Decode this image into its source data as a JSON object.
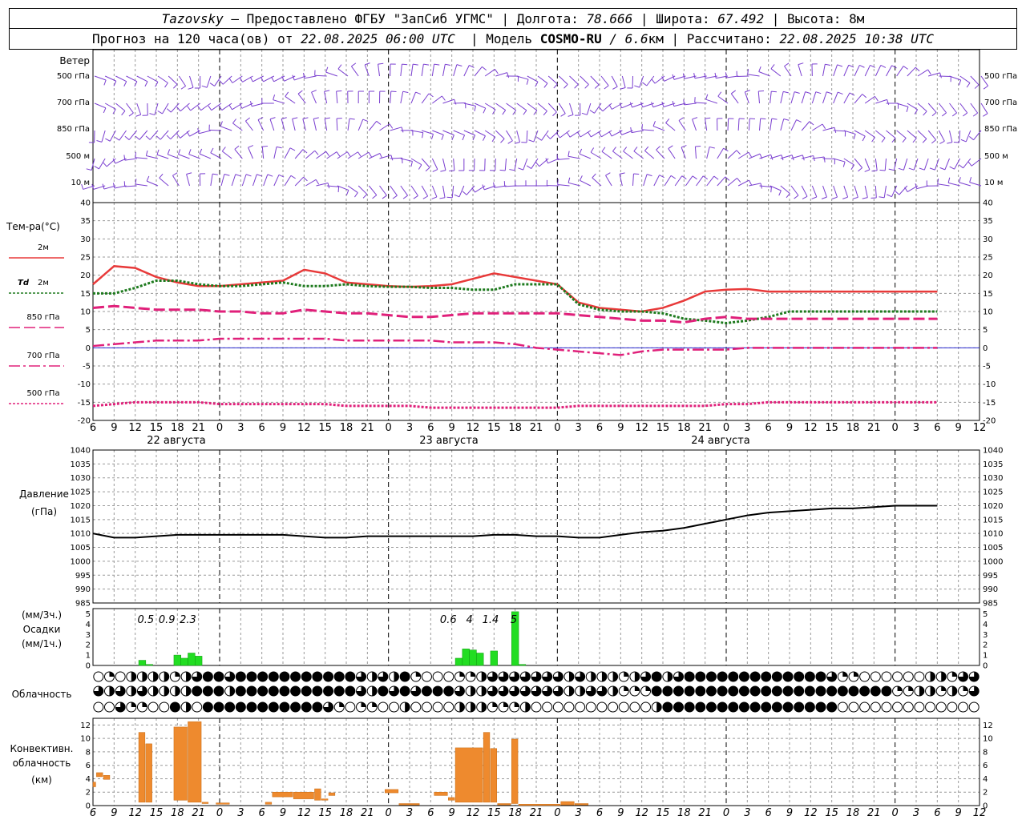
{
  "header": {
    "station": "Tazovsky",
    "provider": "Предоставлено ФГБУ \"ЗапСиб УГМС\"",
    "lon_label": "Долгота:",
    "lon": "78.666",
    "lat_label": "Широта:",
    "lat": "67.492",
    "alt_label": "Высота:",
    "alt": "8м",
    "forecast_prefix": "Прогноз на 120 часа(ов) от",
    "forecast_start": "22.08.2025 06:00 UTC",
    "model_label": "Модель",
    "model_name": "COSMO-RU",
    "model_res": "6.6",
    "model_res_unit": "км",
    "calc_label": "Рассчитано:",
    "calc_time": "22.08.2025 10:38 UTC"
  },
  "wind_panel": {
    "title": "Ветер",
    "levels": [
      "500 гПа",
      "700 гПа",
      "850 гПа",
      "500 м",
      "10 м"
    ]
  },
  "temp_panel": {
    "title": "Тем-ра(°C)",
    "legend": [
      {
        "label": "2м",
        "prefix": "",
        "color": "#e83a3a",
        "style": "solid"
      },
      {
        "label": "2м",
        "prefix": "Td",
        "color": "#1e7a1e",
        "style": "dotted"
      },
      {
        "label": "850 гПа",
        "prefix": "",
        "color": "#e0207a",
        "style": "dashed"
      },
      {
        "label": "700 гПа",
        "prefix": "",
        "color": "#e0207a",
        "style": "dashdot"
      },
      {
        "label": "500 гПа",
        "prefix": "",
        "color": "#e0207a",
        "style": "dotted"
      }
    ],
    "dates": [
      "22 августа",
      "23 августа",
      "24 августа"
    ]
  },
  "pressure_panel": {
    "title": "Давление",
    "unit": "(гПа)"
  },
  "precip_panel": {
    "unit_3h": "(мм/3ч.)",
    "title": "Осадки",
    "unit_1h": "(мм/1ч.)"
  },
  "cloud_panel": {
    "title": "Облачность"
  },
  "conv_panel": {
    "title_1": "Конвективн.",
    "title_2": "облачность",
    "unit": "(км)"
  },
  "chart_data": [
    {
      "type": "line",
      "title": "Тем-ра(°C)",
      "x_hours": [
        0,
        3,
        6,
        9,
        12,
        15,
        18,
        21,
        24,
        27,
        30,
        33,
        36,
        39,
        42,
        45,
        48,
        51,
        54,
        57,
        60,
        63,
        66,
        69,
        72,
        75,
        78,
        81,
        84,
        87,
        90,
        93,
        96,
        99,
        102,
        105,
        108,
        111,
        114,
        117,
        120
      ],
      "x_tick_labels": [
        "6",
        "9",
        "12",
        "15",
        "18",
        "21",
        "0",
        "3",
        "6",
        "9",
        "12",
        "15",
        "18",
        "21",
        "0",
        "3",
        "6",
        "9",
        "12",
        "15",
        "18",
        "21",
        "0",
        "3",
        "6",
        "9",
        "12",
        "15",
        "18",
        "21",
        "0",
        "3",
        "6",
        "9",
        "12",
        "15",
        "18",
        "21",
        "0",
        "3",
        "6",
        "9",
        "12"
      ],
      "ylim": [
        -20,
        40
      ],
      "yticks": [
        -20,
        -15,
        -10,
        -5,
        0,
        5,
        10,
        15,
        20,
        25,
        30,
        35,
        40
      ],
      "series": [
        {
          "name": "2м",
          "values": [
            17.5,
            22.5,
            22,
            19.5,
            18,
            17,
            17,
            17.5,
            18,
            18.5,
            21.5,
            20.5,
            18,
            17.5,
            17,
            16.8,
            17,
            17.5,
            19,
            20.5,
            19.5,
            18.5,
            17.5,
            12.5,
            11,
            10.5,
            10,
            11,
            13,
            15.5,
            16,
            16.2,
            15.5,
            15.5,
            15.5,
            15.5,
            15.5,
            15.5,
            15.5,
            15.5,
            15.5
          ]
        },
        {
          "name": "Td 2м",
          "values": [
            15,
            15,
            16.5,
            18.5,
            18.5,
            17.5,
            17,
            17,
            17.5,
            18,
            17,
            17,
            17.5,
            17,
            16.8,
            16.8,
            16.5,
            16.5,
            16,
            16,
            17.5,
            17.5,
            17.5,
            12,
            10.5,
            10,
            10,
            9.5,
            8,
            7.5,
            6.8,
            7.5,
            8.5,
            10,
            10,
            10,
            10,
            10,
            10,
            10,
            10
          ]
        },
        {
          "name": "850 гПа",
          "values": [
            11,
            11.5,
            11,
            10.5,
            10.5,
            10.5,
            10,
            10,
            9.5,
            9.5,
            10.5,
            10,
            9.5,
            9.5,
            9,
            8.5,
            8.5,
            9,
            9.5,
            9.5,
            9.5,
            9.5,
            9.5,
            9,
            8.5,
            8,
            7.5,
            7.5,
            7,
            8,
            8.5,
            8,
            8,
            8,
            8,
            8,
            8,
            8,
            8,
            8,
            8
          ]
        },
        {
          "name": "700 гПа",
          "values": [
            0.5,
            1,
            1.5,
            2,
            2,
            2,
            2.5,
            2.5,
            2.5,
            2.5,
            2.5,
            2.5,
            2,
            2,
            2,
            2,
            2,
            1.5,
            1.5,
            1.5,
            1,
            0,
            -0.5,
            -1,
            -1.5,
            -2,
            -1,
            -0.5,
            -0.5,
            -0.5,
            -0.5,
            0,
            0,
            0,
            0,
            0,
            0,
            0,
            0,
            0,
            0
          ]
        },
        {
          "name": "500 гПа",
          "values": [
            -16,
            -15.5,
            -15,
            -15,
            -15,
            -15,
            -15.5,
            -15.5,
            -15.5,
            -15.5,
            -15.5,
            -15.5,
            -16,
            -16,
            -16,
            -16,
            -16.5,
            -16.5,
            -16.5,
            -16.5,
            -16.5,
            -16.5,
            -16.5,
            -16,
            -16,
            -16,
            -16,
            -16,
            -16,
            -16,
            -15.5,
            -15.5,
            -15,
            -15,
            -15,
            -15,
            -15,
            -15,
            -15,
            -15,
            -15
          ]
        }
      ]
    },
    {
      "type": "line",
      "title": "Давление",
      "ylabel": "(гПа)",
      "ylim": [
        985,
        1040
      ],
      "yticks": [
        985,
        990,
        995,
        1000,
        1005,
        1010,
        1015,
        1020,
        1025,
        1030,
        1035,
        1040
      ],
      "x_hours": [
        0,
        3,
        6,
        9,
        12,
        15,
        18,
        21,
        24,
        27,
        30,
        33,
        36,
        39,
        42,
        45,
        48,
        51,
        54,
        57,
        60,
        63,
        66,
        69,
        72,
        75,
        78,
        81,
        84,
        87,
        90,
        93,
        96,
        99,
        102,
        105,
        108,
        111,
        114,
        117,
        120
      ],
      "series": [
        {
          "name": "pressure",
          "values": [
            1010,
            1008.5,
            1008.5,
            1009,
            1009.5,
            1009.5,
            1009.5,
            1009.5,
            1009.5,
            1009.5,
            1009,
            1008.5,
            1008.5,
            1009,
            1009,
            1009,
            1009,
            1009,
            1009,
            1009.5,
            1009.5,
            1009,
            1009,
            1008.5,
            1008.5,
            1009.5,
            1010.5,
            1011,
            1012,
            1013.5,
            1015,
            1016.5,
            1017.5,
            1018,
            1018.5,
            1019,
            1019,
            1019.5,
            1020,
            1020,
            1020
          ]
        }
      ]
    },
    {
      "type": "bar",
      "title": "Осадки",
      "ylim": [
        0,
        5
      ],
      "yticks": [
        0,
        1,
        2,
        3,
        4,
        5
      ],
      "bars_hourly": [
        {
          "hour": 7,
          "value": 0.5
        },
        {
          "hour": 8,
          "value": 0.1
        },
        {
          "hour": 12,
          "value": 1.0
        },
        {
          "hour": 13,
          "value": 0.7
        },
        {
          "hour": 14,
          "value": 1.2
        },
        {
          "hour": 15,
          "value": 0.9
        },
        {
          "hour": 52,
          "value": 0.7
        },
        {
          "hour": 53,
          "value": 1.6
        },
        {
          "hour": 54,
          "value": 1.5
        },
        {
          "hour": 55,
          "value": 1.2
        },
        {
          "hour": 57,
          "value": 1.4
        },
        {
          "hour": 60,
          "value": 5.2
        },
        {
          "hour": 61,
          "value": 0.1
        }
      ],
      "annotations_3h": [
        {
          "hour": 7.5,
          "label": "0.5"
        },
        {
          "hour": 10.5,
          "label": "0.9"
        },
        {
          "hour": 13.5,
          "label": "2.3"
        },
        {
          "hour": 50.5,
          "label": "0.6"
        },
        {
          "hour": 53.5,
          "label": "4"
        },
        {
          "hour": 56.5,
          "label": "1.4"
        },
        {
          "hour": 59.8,
          "label": "5"
        }
      ]
    },
    {
      "type": "table",
      "title": "Облачность",
      "rows": 3,
      "columns": 81,
      "row_cover_fraction": [
        [
          0,
          0.25,
          0,
          0.5,
          0.5,
          0.5,
          0.5,
          0.25,
          0.5,
          0.75,
          1,
          1,
          0.75,
          1,
          1,
          1,
          1,
          1,
          1,
          1,
          1,
          1,
          1,
          1,
          0.75,
          0.5,
          0.75,
          0.5,
          1,
          0.25,
          0,
          0,
          0,
          0.25,
          0.25,
          0.5,
          0.75,
          0.75,
          0.75,
          0.75,
          0.75,
          0.75,
          0.75,
          0.5,
          0.75,
          0.5,
          0.5,
          0.5,
          0.25,
          0.5,
          0.75,
          1,
          0.5,
          0.75,
          1,
          1,
          1,
          1,
          1,
          1,
          1,
          1,
          1,
          1,
          1,
          1,
          1,
          0.75,
          0.25,
          0.25,
          0,
          0,
          0,
          0,
          0,
          0,
          0.5,
          0.5,
          0.25,
          0.75,
          0.75
        ],
        [
          0.75,
          0.5,
          0.75,
          0.5,
          0.75,
          0.5,
          0.5,
          0.5,
          0.5,
          1,
          1,
          1,
          0.5,
          1,
          1,
          1,
          1,
          1,
          1,
          1,
          1,
          1,
          1,
          1,
          0.75,
          0.5,
          1,
          0.75,
          1,
          0.75,
          1,
          1,
          1,
          0.75,
          0.5,
          0.5,
          0.75,
          0.75,
          0.75,
          0.75,
          0.75,
          0.75,
          0.75,
          0.5,
          0.5,
          0.75,
          0.75,
          0.5,
          0.25,
          0.25,
          0.25,
          1,
          1,
          1,
          1,
          1,
          1,
          1,
          1,
          1,
          1,
          1,
          1,
          1,
          1,
          1,
          1,
          1,
          1,
          1,
          1,
          1,
          1,
          0.25,
          0.25,
          0.5,
          0.5,
          0.25,
          0.5,
          0.25,
          0.75
        ],
        [
          0,
          0,
          0.75,
          0.25,
          0.25,
          0,
          0,
          1,
          0.5,
          0,
          1,
          1,
          1,
          1,
          1,
          1,
          1,
          1,
          1,
          1,
          1,
          0.75,
          0.25,
          0,
          0.25,
          0.25,
          0,
          0,
          0.5,
          0,
          0,
          0,
          0,
          0.5,
          0.5,
          0.5,
          0.25,
          0.25,
          0.25,
          0.5,
          0,
          0,
          0,
          0,
          0,
          0,
          0,
          0,
          0,
          0,
          0,
          0.5,
          1,
          1,
          1,
          1,
          1,
          1,
          1,
          1,
          1,
          1,
          1,
          1,
          1,
          1,
          1,
          1,
          0,
          0,
          0,
          0,
          0,
          0,
          0,
          0,
          0,
          0,
          0,
          0,
          0
        ]
      ]
    },
    {
      "type": "bar",
      "title": "Конвективн. облачность",
      "ylabel": "(км)",
      "ylim": [
        0,
        13
      ],
      "yticks": [
        0,
        2,
        4,
        6,
        8,
        10,
        12
      ],
      "bars": [
        {
          "h0": 0,
          "h1": 0.5,
          "base": 2.8,
          "top": 3.5
        },
        {
          "h0": 0.5,
          "h1": 1.5,
          "base": 4.3,
          "top": 4.9
        },
        {
          "h0": 1.5,
          "h1": 2.5,
          "base": 3.9,
          "top": 4.5
        },
        {
          "h0": 6.5,
          "h1": 7.5,
          "base": 0.5,
          "top": 10.9
        },
        {
          "h0": 7.5,
          "h1": 8.5,
          "base": 0.5,
          "top": 9.2
        },
        {
          "h0": 11.5,
          "h1": 13.5,
          "base": 0.8,
          "top": 11.7
        },
        {
          "h0": 13.5,
          "h1": 15.5,
          "base": 0.5,
          "top": 12.5
        },
        {
          "h0": 15.5,
          "h1": 16.5,
          "base": 0.3,
          "top": 0.5
        },
        {
          "h0": 17.5,
          "h1": 19.5,
          "base": 0.2,
          "top": 0.4
        },
        {
          "h0": 24.5,
          "h1": 25.5,
          "base": 0.2,
          "top": 0.5
        },
        {
          "h0": 25.5,
          "h1": 28.5,
          "base": 1.3,
          "top": 2.0
        },
        {
          "h0": 28.5,
          "h1": 31.5,
          "base": 1.0,
          "top": 2.0
        },
        {
          "h0": 31.5,
          "h1": 32.5,
          "base": 0.8,
          "top": 2.5
        },
        {
          "h0": 32.5,
          "h1": 33.5,
          "base": 0.8,
          "top": 1.0
        },
        {
          "h0": 33.5,
          "h1": 34.5,
          "base": 1.5,
          "top": 1.9
        },
        {
          "h0": 41.5,
          "h1": 43.5,
          "base": 1.9,
          "top": 2.4
        },
        {
          "h0": 43.5,
          "h1": 46.5,
          "base": 0.1,
          "top": 0.3
        },
        {
          "h0": 48.5,
          "h1": 50.5,
          "base": 1.5,
          "top": 2.0
        },
        {
          "h0": 50.5,
          "h1": 51.5,
          "base": 0.8,
          "top": 1.2
        },
        {
          "h0": 51.5,
          "h1": 55.5,
          "base": 0.5,
          "top": 8.6
        },
        {
          "h0": 55.5,
          "h1": 56.5,
          "base": 0.5,
          "top": 10.9
        },
        {
          "h0": 56.5,
          "h1": 57.5,
          "base": 0.5,
          "top": 8.5
        },
        {
          "h0": 57.5,
          "h1": 59.5,
          "base": 0.1,
          "top": 0.3
        },
        {
          "h0": 59.5,
          "h1": 60.5,
          "base": 0.3,
          "top": 9.9
        },
        {
          "h0": 60.5,
          "h1": 66.5,
          "base": 0.1,
          "top": 0.2
        },
        {
          "h0": 66.5,
          "h1": 68.5,
          "base": 0.1,
          "top": 0.6
        },
        {
          "h0": 68.5,
          "h1": 70.5,
          "base": 0.1,
          "top": 0.3
        }
      ]
    }
  ]
}
